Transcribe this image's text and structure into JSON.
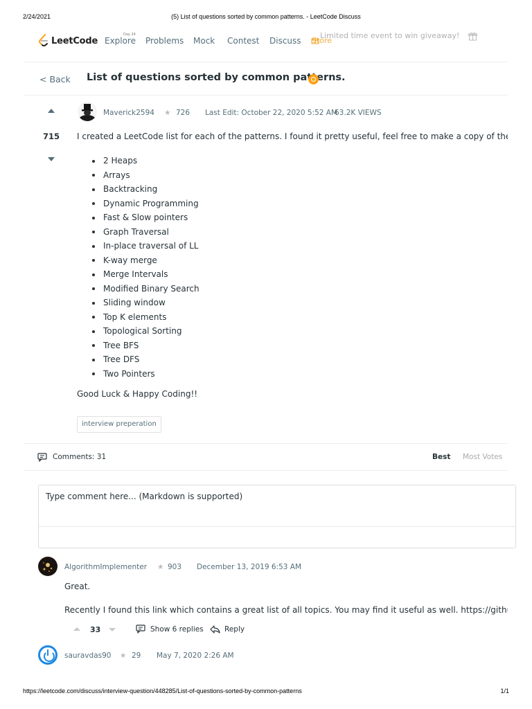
{
  "print": {
    "date": "2/24/2021",
    "title": "(5) List of questions sorted by common patterns. - LeetCode Discuss",
    "url": "https://leetcode.com/discuss/interview-question/448285/List-of-questions-sorted-by-common-patterns",
    "page": "1/1"
  },
  "nav": {
    "logo": "LeetCode",
    "explore_badge": "Day 24",
    "explore": "Explore",
    "problems": "Problems",
    "mock": "Mock",
    "contest": "Contest",
    "discuss": "Discuss",
    "store": "Store",
    "promo": "Limited time event to win giveaway!"
  },
  "topic": {
    "back": "< Back",
    "title": "List of questions sorted by common patterns.",
    "votes": "715",
    "author": "Maverick2594",
    "reputation": "726",
    "edited": "Last Edit: October 22, 2020 5:52 AM",
    "views": "63.2K VIEWS",
    "intro": "I created a LeetCode list for each of the patterns. I found it pretty useful, feel free to make a copy of the list",
    "patterns": [
      "2 Heaps",
      "Arrays",
      "Backtracking",
      "Dynamic Programming",
      "Fast & Slow pointers",
      "Graph Traversal",
      "In-place traversal of LL",
      "K-way merge",
      "Merge Intervals",
      "Modified Binary Search",
      "Sliding window",
      "Top K elements",
      "Topological Sorting",
      "Tree BFS",
      "Tree DFS",
      "Two Pointers"
    ],
    "closing": "Good Luck & Happy Coding!!",
    "tag": "interview preperation"
  },
  "comments": {
    "label": "Comments: 31",
    "sort_best": "Best",
    "sort_most_votes": "Most Votes",
    "input_placeholder": "Type comment here... (Markdown is supported)",
    "items": [
      {
        "author": "AlgorithmImplementer",
        "reputation": "903",
        "date": "December 13, 2019 6:53 AM",
        "text1": "Great.",
        "text2": "Recently I found this link which contains a great list of all topics. You may find it useful as well. https://github.com",
        "votes": "33",
        "replies": "Show 6 replies",
        "reply": "Reply"
      },
      {
        "author": "sauravdas90",
        "reputation": "29",
        "date": "May 7, 2020 2:26 AM"
      }
    ]
  },
  "icons": {
    "star": "star-icon",
    "comments": "comment-icon",
    "reply": "reply-icon",
    "gift": "gift-icon"
  },
  "colors": {
    "brand_orange": "#ffa116",
    "text_primary": "#263238",
    "text_secondary": "#546e7a",
    "avatar_blue": "#1e88e5"
  }
}
